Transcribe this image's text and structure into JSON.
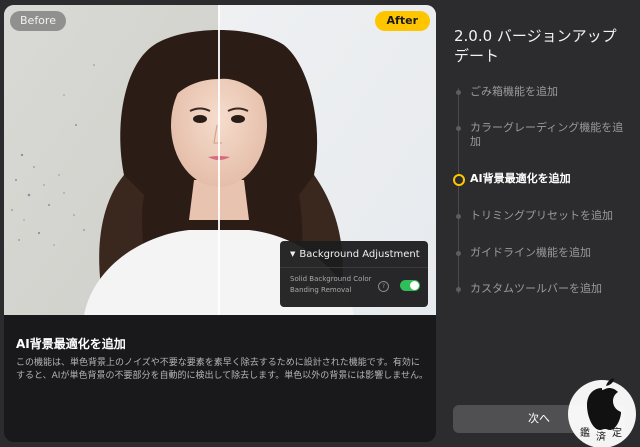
{
  "preview": {
    "before_label": "Before",
    "after_label": "After",
    "panel": {
      "title": "Background Adjustment",
      "option_label": "Solid Background Color Banding Removal",
      "help_icon": "?",
      "toggle_on": true
    }
  },
  "feature": {
    "title": "AI背景最適化を追加",
    "description": "この機能は、単色背景上のノイズや不要な要素を素早く除去するために設計された機能です。有効にすると、AIが単色背景の不要部分を自動的に検出して除去します。単色以外の背景には影響しません。"
  },
  "sidebar": {
    "title": "2.0.0 バージョンアップデート",
    "items": [
      {
        "label": "ごみ箱機能を追加",
        "active": false
      },
      {
        "label": "カラーグレーディング機能を追加",
        "active": false
      },
      {
        "label": "AI背景最適化を追加",
        "active": true
      },
      {
        "label": "トリミングプリセットを追加",
        "active": false
      },
      {
        "label": "ガイドライン機能を追加",
        "active": false
      },
      {
        "label": "カスタムツールバーを追加",
        "active": false
      }
    ],
    "next_label": "次へ"
  },
  "watermark": {
    "chars": [
      "鑑",
      "済",
      "定"
    ]
  },
  "colors": {
    "accent": "#ffc600",
    "toggle": "#2fbe5a"
  }
}
